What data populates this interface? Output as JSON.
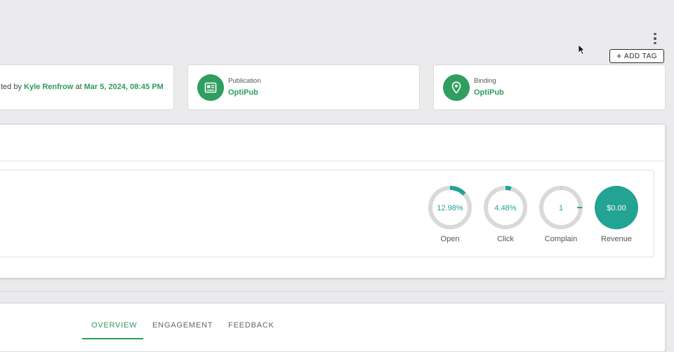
{
  "toolbar": {
    "add_tag_label": "ADD TAG"
  },
  "info": {
    "created_prefix": "ted by",
    "created_by": "Kyle Renfrow",
    "created_at_word": "at",
    "created_at": "Mar 5, 2024, 08:45 PM",
    "publication_label": "Publication",
    "publication_value": "OptiPub",
    "binding_label": "Binding",
    "binding_value": "OptiPub"
  },
  "stats": [
    {
      "name": "Open",
      "display": "12.98%",
      "fraction": 0.1298
    },
    {
      "name": "Click",
      "display": "4.48%",
      "fraction": 0.0448
    },
    {
      "name": "Complain",
      "display": "1",
      "fraction": 0.002
    },
    {
      "name": "Revenue",
      "display": "$0.00",
      "fraction": 1
    }
  ],
  "tabs": [
    {
      "label": "OVERVIEW",
      "active": true
    },
    {
      "label": "ENGAGEMENT",
      "active": false
    },
    {
      "label": "FEEDBACK",
      "active": false
    }
  ],
  "colors": {
    "accent_green": "#2a9d5c",
    "icon_green": "#2f9e5f",
    "stat_teal": "#23a393",
    "ring_gray": "#d9d9d9"
  },
  "icons": [
    "more-vert-icon",
    "plus-icon",
    "newspaper-icon",
    "location-pin-icon",
    "mouse-cursor-icon"
  ]
}
